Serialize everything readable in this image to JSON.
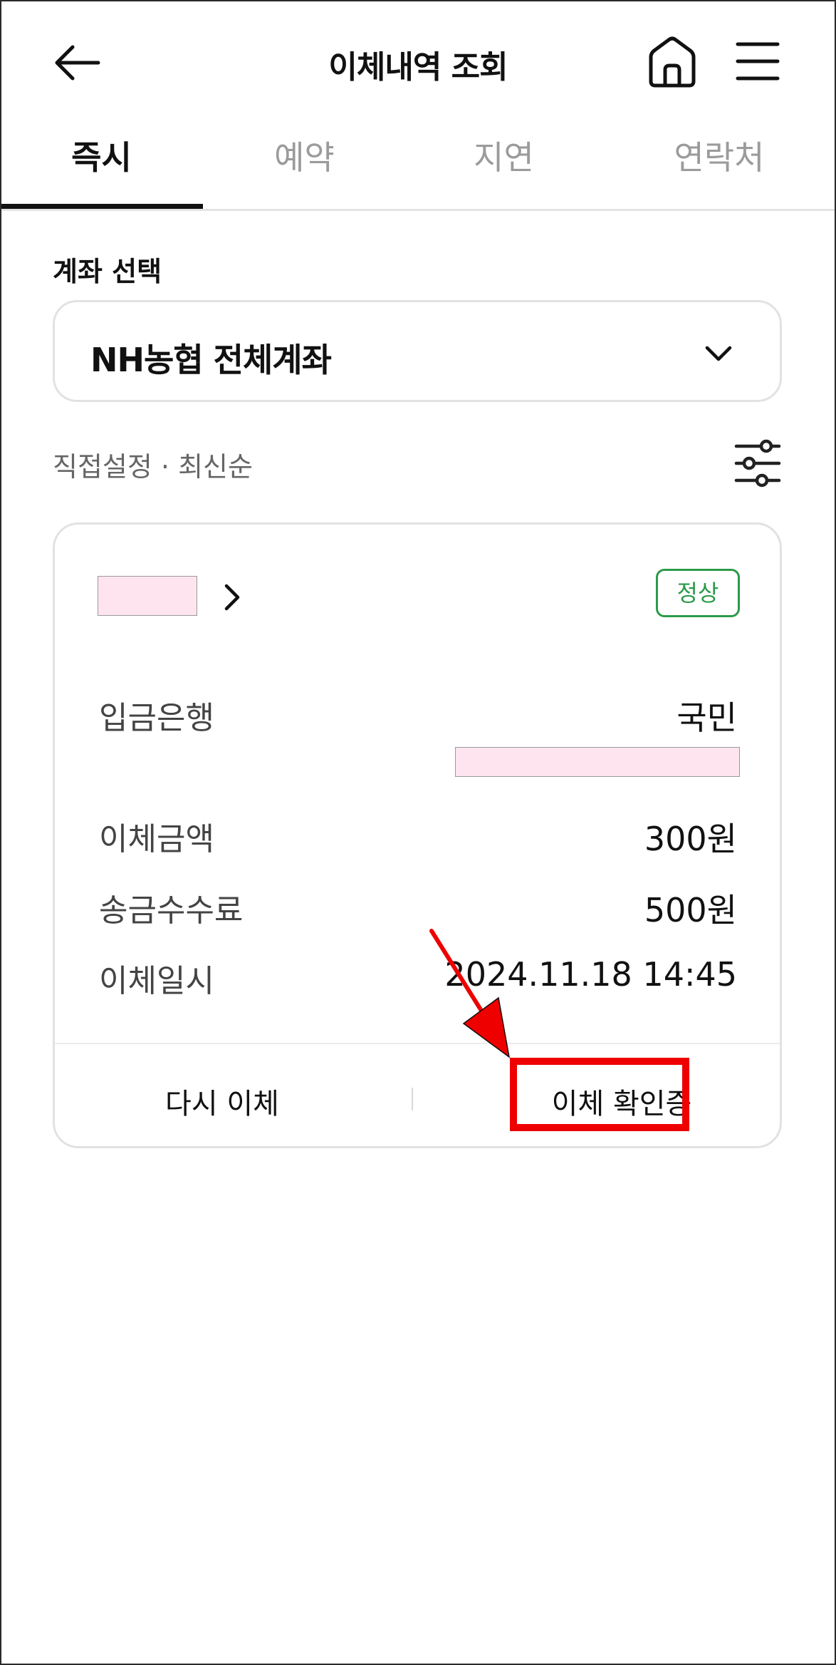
{
  "header": {
    "title": "이체내역 조회",
    "back_icon": "arrow-left-icon",
    "home_icon": "home-icon",
    "menu_icon": "hamburger-menu-icon"
  },
  "tabs": [
    {
      "label": "즉시",
      "active": true
    },
    {
      "label": "예약",
      "active": false
    },
    {
      "label": "지연",
      "active": false
    },
    {
      "label": "연락처",
      "active": false
    }
  ],
  "account": {
    "section_label": "계좌 선택",
    "selected": "NH농협 전체계좌"
  },
  "sort": {
    "label": "직접설정 · 최신순",
    "filter_icon": "sliders-icon"
  },
  "transaction": {
    "status": "정상",
    "rows": [
      {
        "label": "입금은행",
        "value": "국민"
      },
      {
        "label": "이체금액",
        "value": "300원"
      },
      {
        "label": "송금수수료",
        "value": "500원"
      },
      {
        "label": "이체일시",
        "value": "2024.11.18 14:45"
      }
    ],
    "actions": {
      "retransfer": "다시 이체",
      "confirmation": "이체 확인증"
    }
  },
  "colors": {
    "status_green": "#2c9a4a",
    "annotation_red": "#ee0000",
    "redaction_pink": "#fde4ef"
  }
}
